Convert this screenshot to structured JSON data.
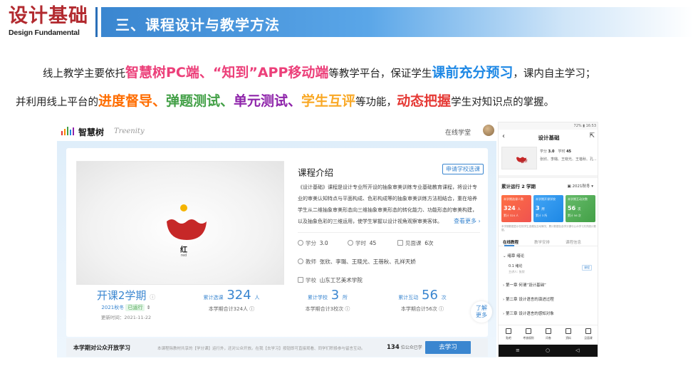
{
  "header": {
    "brand_cn": "设计基础",
    "brand_en": "Design Fundamental",
    "title": "三、课程设计与教学方法",
    "colors": {
      "brand_red": "#b22a2f",
      "header_blue": "#3a86d0"
    }
  },
  "paragraph": {
    "line1": {
      "t1": "线上教学主要依托",
      "h1": "智慧树PC端、“知到”APP移动端",
      "t2": "等教学平台，保证学生",
      "h2": "课前充分预习",
      "t3": "，课内自主学习；"
    },
    "line2": {
      "t1": "并利用线上平台的",
      "h1": "进度督导、",
      "h2": "弹题测试、",
      "h3": "单元测试、",
      "h4": "学生互评",
      "t2": "等功能，",
      "h5": "动态把握",
      "t3": "学生对知识点的掌握。"
    }
  },
  "pc": {
    "logo_cn": "智慧树",
    "logo_en": "Treenity",
    "online": "在线学堂",
    "video": {
      "cn": "红",
      "en": "red"
    },
    "intro_title": "课程介绍",
    "apply_btn": "申请学校选课",
    "intro_text": "《设计基础》课程是设计专业所开设的抽象审美训练专业基础教育课程，将设计专业的审美认知特点与平面构成、色彩构成等的抽象审美训练方法相结合，重在培养学生从二维抽象审美形态向三维抽象审美形态的转化能力、功能形态的审美构建，以及抽象色彩的三维运用，使学生掌握以设计视角观察审美客体。",
    "more": "查看更多",
    "credit_label": "学分",
    "credit": "3.0",
    "hours_label": "学时",
    "hours": "45",
    "meet_label": "见面课",
    "meet": "6次",
    "teacher_label": "教师",
    "teachers": "张欣、李璐、王晓光、王蓓秋、孔祥天娇",
    "school_label": "学校",
    "school": "山东工艺美术学院",
    "term_big": "开课2学期",
    "term_sub": "2021秋冬",
    "term_status": "已运行",
    "update_time": "更新时间：2021-11-22",
    "stat1": {
      "label": "累计选课",
      "num": "324",
      "unit": "人",
      "sub": "本学期合计324人"
    },
    "stat2": {
      "label": "累计学校",
      "num": "3",
      "unit": "所",
      "sub": "本学期合计3校次"
    },
    "stat3": {
      "label": "累计互动",
      "num": "56",
      "unit": "次",
      "sub": "本学期合计56次"
    },
    "more_side": [
      "了解",
      "更多"
    ],
    "bottom_title": "本学期对公众开放学习",
    "bottom_desc": "本课程除教材共享的【学分课】运行外，还对公众开放。在我【去学习】按钮即可直接观看、同学们积极参与留言互动。",
    "bottom_num": "134",
    "bottom_num_lbl": "位公众已学",
    "bottom_btn": "去学习"
  },
  "phone": {
    "status_right": "72% ▮ 16:53",
    "title": "设计基础",
    "cover_tag": "设计",
    "meta1_k1": "学分",
    "meta1_v1": "3.0",
    "meta1_k2": "学时",
    "meta1_v2": "45",
    "meta2": "张欣、李璐、王晓光、王蓓秋、孔...",
    "run": "累计运行 2 学期",
    "term": "2021秋冬 ▾",
    "card1": {
      "t": "本学期选课人数",
      "n": "324",
      "u": "人",
      "s": "累计 324 人"
    },
    "card2": {
      "t": "本学期开课学校",
      "n": "3",
      "u": "所",
      "s": "累计 3 所"
    },
    "card3": {
      "t": "本学期互动次数",
      "n": "56",
      "u": "次",
      "s": "累计 56 次"
    },
    "note": "本学期数据显示在校学生选课及互动情况，累计数据包含学分课与公众学习共同统计数据。",
    "tabs": [
      "在线教程",
      "教学安排",
      "课程信息"
    ],
    "ch0": "绪章 绪论",
    "sub1": "0.1 绪论",
    "sub1b": "主讲人: 张欣",
    "chip": "课程",
    "ch1": "第一章 何谓“设计基础”",
    "ch2": "第二章 设计语言的演进过程",
    "ch3": "第三章 设计语言的感知对象",
    "bar": [
      "贴吧",
      "考核规则",
      "问卷",
      "资料",
      "见面课"
    ]
  }
}
